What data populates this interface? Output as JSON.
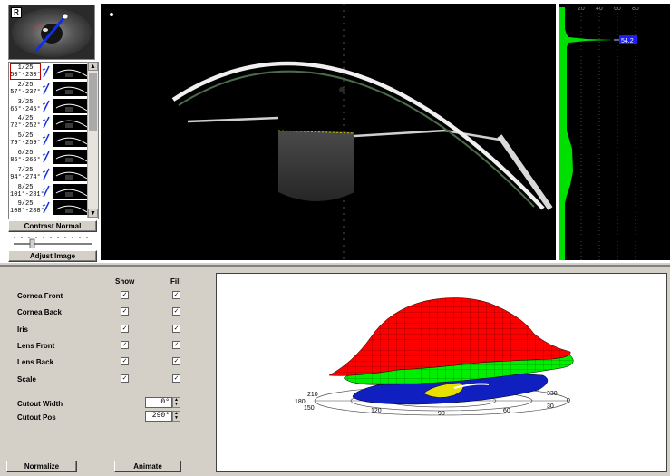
{
  "eye_thumbnail": {
    "badge": "R"
  },
  "scan_list": {
    "items": [
      {
        "index": "1/25",
        "angle": "50°-230°",
        "selected": true
      },
      {
        "index": "2/25",
        "angle": "57°-237°",
        "selected": false
      },
      {
        "index": "3/25",
        "angle": "65°-245°",
        "selected": false
      },
      {
        "index": "4/25",
        "angle": "72°-252°",
        "selected": false
      },
      {
        "index": "5/25",
        "angle": "79°-259°",
        "selected": false
      },
      {
        "index": "6/25",
        "angle": "86°-266°",
        "selected": false
      },
      {
        "index": "7/25",
        "angle": "94°-274°",
        "selected": false
      },
      {
        "index": "8/25",
        "angle": "101°-281°",
        "selected": false
      },
      {
        "index": "9/25",
        "angle": "108°-288°",
        "selected": false
      }
    ]
  },
  "controls": {
    "contrast_label": "Contrast Normal",
    "adjust_label": "Adjust Image"
  },
  "densitogram": {
    "ticks": [
      "20",
      "40",
      "60",
      "80"
    ],
    "peak_value": "54.2",
    "fill_color": "#00e000"
  },
  "layers_panel": {
    "show_header": "Show",
    "fill_header": "Fill",
    "layers": [
      {
        "label": "Cornea Front",
        "show": true,
        "fill": true
      },
      {
        "label": "Cornea Back",
        "show": true,
        "fill": true
      },
      {
        "label": "Iris",
        "show": true,
        "fill": true
      },
      {
        "label": "Lens Front",
        "show": true,
        "fill": true
      },
      {
        "label": "Lens Back",
        "show": true,
        "fill": true
      },
      {
        "label": "Scale",
        "show": true,
        "fill": true
      }
    ],
    "cutout_width_label": "Cutout Width",
    "cutout_width_value": "0°",
    "cutout_pos_label": "Cutout Pos",
    "cutout_pos_value": "290°",
    "normalize_label": "Normalize",
    "animate_label": "Animate"
  },
  "view3d": {
    "scale_labels": [
      "180",
      "210",
      "150",
      "120",
      "90",
      "60",
      "30",
      "330",
      "0"
    ],
    "colors": {
      "cornea_front": "#ff0000",
      "cornea_back": "#00ee00",
      "iris": "#1020c0",
      "lens": "#e8e000"
    }
  }
}
